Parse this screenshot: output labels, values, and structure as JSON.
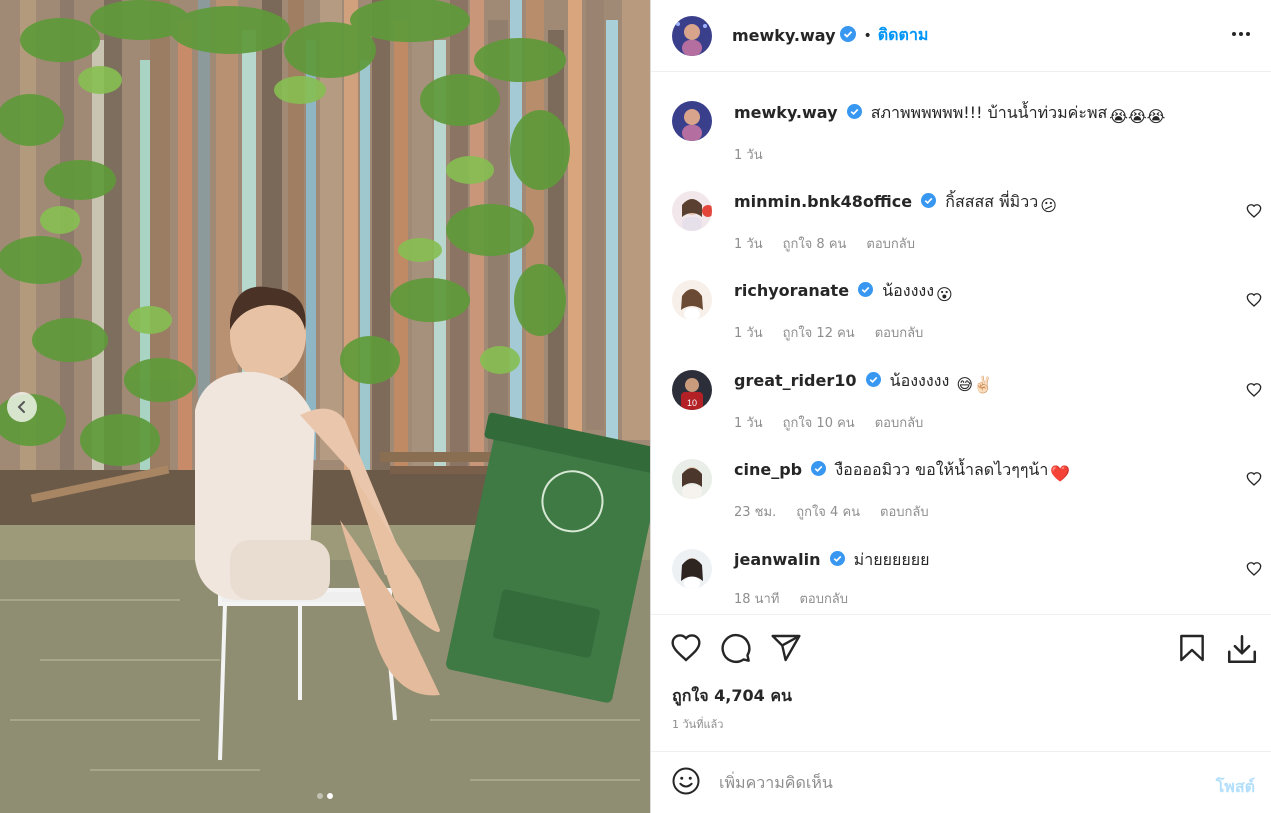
{
  "post": {
    "author": "mewky.way",
    "follow_label": "ติดตาม",
    "separator": "•",
    "more_icon": "more-horizontal-icon"
  },
  "caption": {
    "username": "mewky.way",
    "text": "สภาพพพพพพ!!! บ้านน้ำท่วมค่ะพส",
    "emoji": "😭😭😭",
    "time": "1 วัน"
  },
  "comments": [
    {
      "username": "minmin.bnk48office",
      "text": "กิ้สสสส พี่มิวว",
      "emoji": "😕",
      "time": "1 วัน",
      "likes": "ถูกใจ 8 คน",
      "reply": "ตอบกลับ"
    },
    {
      "username": "richyoranate",
      "text": "น้องงงง",
      "emoji": "😮",
      "time": "1 วัน",
      "likes": "ถูกใจ 12 คน",
      "reply": "ตอบกลับ"
    },
    {
      "username": "great_rider10",
      "text": "น้องงงงง",
      "emoji": "😅✌🏻",
      "time": "1 วัน",
      "likes": "ถูกใจ 10 คน",
      "reply": "ตอบกลับ"
    },
    {
      "username": "cine_pb",
      "text": "งืออออมิวว ขอให้น้ำลดไวๆๆน้า",
      "emoji": "❤️",
      "time": "23 ชม.",
      "likes": "ถูกใจ 4 คน",
      "reply": "ตอบกลับ"
    },
    {
      "username": "jeanwalin",
      "text": "ม่ายยยยยย",
      "emoji": "",
      "time": "18 นาที",
      "likes": "",
      "reply": "ตอบกลับ"
    }
  ],
  "actions": {
    "like_icon": "heart-outline-icon",
    "comment_icon": "comment-bubble-icon",
    "share_icon": "paper-plane-icon",
    "save_icon": "bookmark-icon",
    "download_icon": "download-icon",
    "likes_text": "ถูกใจ 4,704 คน",
    "posted_time": "1 วันที่แล้ว"
  },
  "add_comment": {
    "placeholder": "เพิ่มความคิดเห็น",
    "post_label": "โพสต์",
    "emoji_icon": "smiley-icon"
  },
  "carousel": {
    "slide_count": 2,
    "active_slide": 2
  },
  "colors": {
    "accent": "#0095f6",
    "verified": "#3897f0",
    "muted": "#8e8e8e",
    "post_disabled": "#b2dffc"
  }
}
